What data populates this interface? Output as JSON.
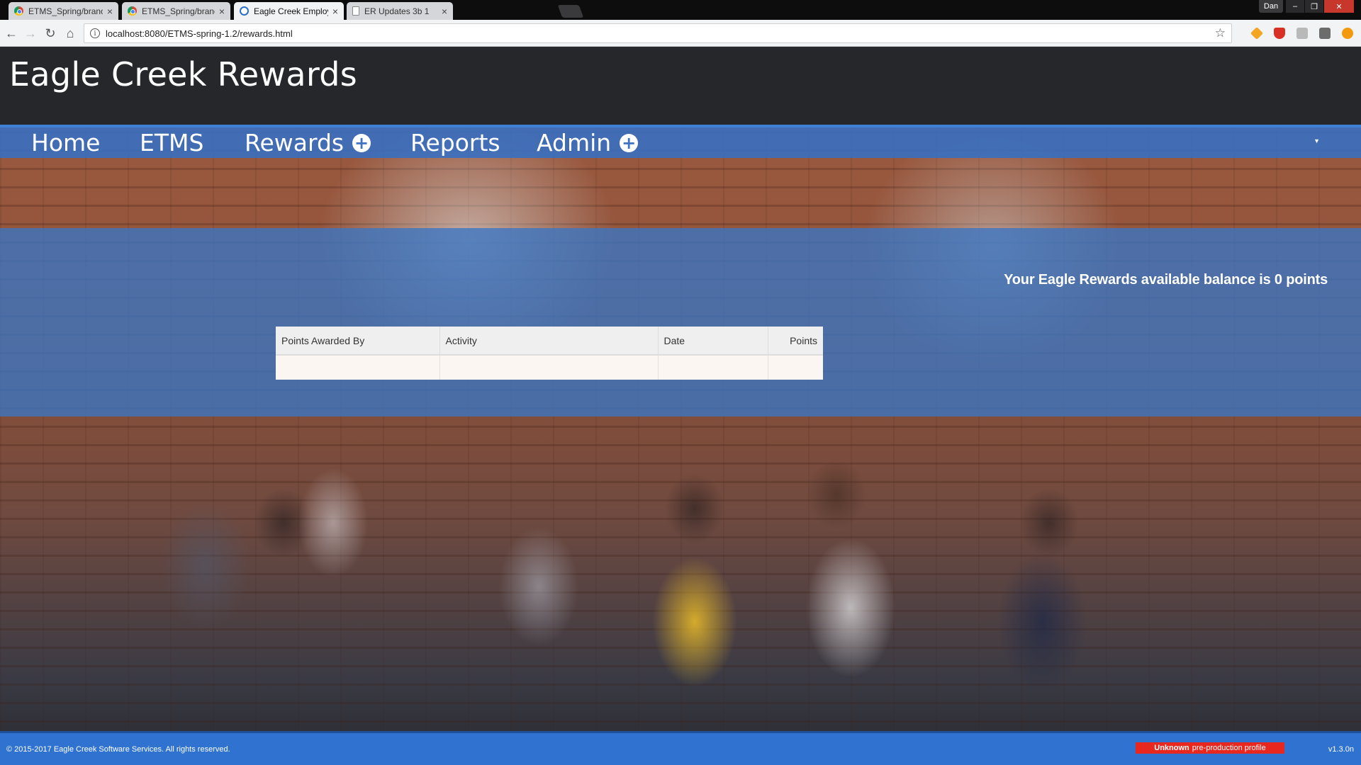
{
  "browser": {
    "tabs": [
      {
        "title": "ETMS_Spring/branches/",
        "icon": "chrome-icon",
        "active": false
      },
      {
        "title": "ETMS_Spring/branches/",
        "icon": "chrome-icon",
        "active": false
      },
      {
        "title": "Eagle Creek Employees",
        "icon": "eagle-creek-icon",
        "active": true
      },
      {
        "title": "ER Updates 3b 1",
        "icon": "document-icon",
        "active": false
      }
    ],
    "user": "Dan",
    "url": "localhost:8080/ETMS-spring-1.2/rewards.html"
  },
  "header": {
    "title": "Eagle Creek Rewards"
  },
  "nav": {
    "items": [
      {
        "label": "Home",
        "has_submenu": false
      },
      {
        "label": "ETMS",
        "has_submenu": false
      },
      {
        "label": "Rewards",
        "has_submenu": true
      },
      {
        "label": "Reports",
        "has_submenu": false
      },
      {
        "label": "Admin",
        "has_submenu": true
      }
    ]
  },
  "balance": {
    "text": "Your Eagle Rewards available balance is 0 points",
    "points": 0
  },
  "table": {
    "columns": [
      "Points Awarded By",
      "Activity",
      "Date",
      "Points"
    ],
    "rows": []
  },
  "footer": {
    "copyright": "© 2015-2017 Eagle Creek Software Services. All rights reserved.",
    "profile_bold": "Unknown",
    "profile_rest": "pre-production profile",
    "version": "v1.3.0n"
  },
  "colors": {
    "header_bg": "#25272b",
    "nav_blue": "#3670c4",
    "footer_blue": "#2f72d0",
    "badge_red": "#e8281f"
  }
}
